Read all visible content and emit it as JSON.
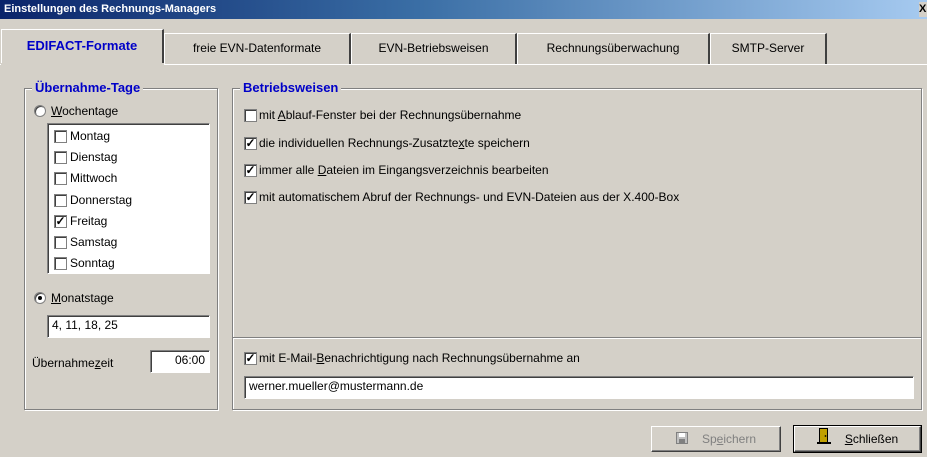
{
  "window": {
    "title": "Einstellungen des Rechnungs-Managers",
    "close_glyph": "X"
  },
  "tabs": [
    {
      "label": "EDIFACT-Formate"
    },
    {
      "label": "freie EVN-Datenformate"
    },
    {
      "label": "EVN-Betriebsweisen"
    },
    {
      "label": "Rechnungsüberwachung"
    },
    {
      "label": "SMTP-Server"
    }
  ],
  "uebernahme": {
    "title": "Übernahme-Tage",
    "wochentage_u": "W",
    "wochentage_rest": "ochentage",
    "monatstage_u": "M",
    "monatstage_rest": "onatstage",
    "mode": "Monatstage",
    "days": [
      {
        "label": "Montag",
        "checked": false
      },
      {
        "label": "Dienstag",
        "checked": false
      },
      {
        "label": "Mittwoch",
        "checked": false
      },
      {
        "label": "Donnerstag",
        "checked": false
      },
      {
        "label": "Freitag",
        "checked": true
      },
      {
        "label": "Samstag",
        "checked": false
      },
      {
        "label": "Sonntag",
        "checked": false
      }
    ],
    "monatstage_value": "4, 11, 18, 25",
    "zeit_pre": "Übernahme",
    "zeit_u": "z",
    "zeit_post": "eit",
    "zeit_value": "06:00"
  },
  "betrieb": {
    "title": "Betriebsweisen",
    "options": [
      {
        "pre": "mit ",
        "u": "A",
        "post": "blauf-Fenster bei der Rechnungsübernahme",
        "checked": false
      },
      {
        "pre": "die individuellen Rechnungs-Zusatzte",
        "u": "x",
        "post": "te speichern",
        "checked": true
      },
      {
        "pre": "immer alle ",
        "u": "D",
        "post": "ateien im Eingangsverzeichnis bearbeiten",
        "checked": true
      },
      {
        "pre": "mit automatischem Abruf der Rechnungs- und EVN-Dateien aus der X.400-Box",
        "u": "",
        "post": "",
        "checked": true
      }
    ],
    "email_opt": {
      "pre": "mit E-Mail-",
      "u": "B",
      "post": "enachrichtigung nach Rechnungsübernahme an",
      "checked": true
    },
    "email_value": "werner.mueller@mustermann.de"
  },
  "buttons": {
    "save_pre": "Sp",
    "save_u": "e",
    "save_post": "ichern",
    "close_u": "S",
    "close_post": "chließen"
  },
  "colors": {
    "accent": "#0000c8",
    "face": "#d4d0c8",
    "title_start": "#0a246a",
    "title_end": "#a6caf0"
  },
  "icons": {
    "save": "floppy-disk-icon",
    "close": "door-exit-icon"
  }
}
